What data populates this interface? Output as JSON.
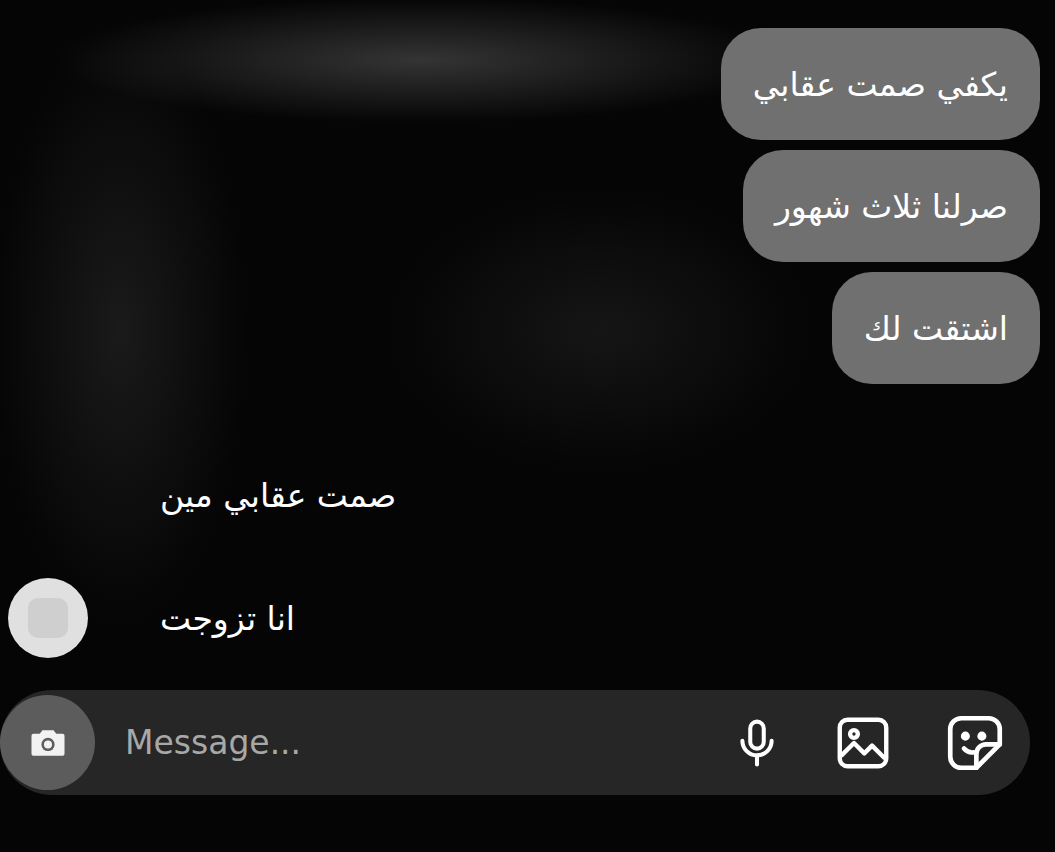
{
  "conversation": {
    "messages": [
      {
        "kind": "sent",
        "text": "يكفي صمت عقابي",
        "avatar": false
      },
      {
        "kind": "sent",
        "text": "صرلنا ثلاث شهور",
        "avatar": false
      },
      {
        "kind": "sent",
        "text": "اشتقت لك",
        "avatar": false
      },
      {
        "kind": "received",
        "text": "صمت عقابي مين",
        "avatar": false
      },
      {
        "kind": "received",
        "text": "انا تزوجت",
        "avatar": true
      }
    ]
  },
  "composer": {
    "placeholder": "Message..."
  }
}
